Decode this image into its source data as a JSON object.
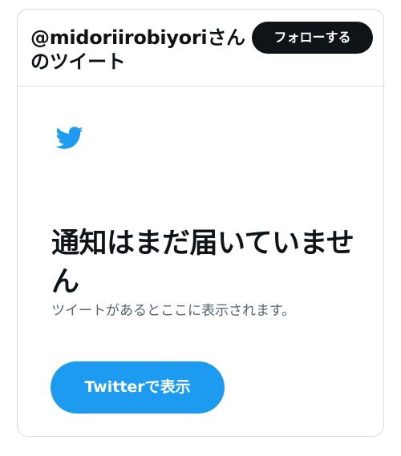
{
  "header": {
    "title": "@midoriirobiyoriさんのツイート",
    "follow_label": "フォローする"
  },
  "empty_state": {
    "icon": "twitter-bird-icon",
    "title": "通知はまだ届いていません",
    "subtitle": "ツイートがあるとここに表示されます。",
    "view_button_label": "Twitterで表示"
  },
  "colors": {
    "brand_blue": "#1d9bf0",
    "text_primary": "#0f1419",
    "text_secondary": "#536471",
    "border": "#d6dbe0"
  }
}
